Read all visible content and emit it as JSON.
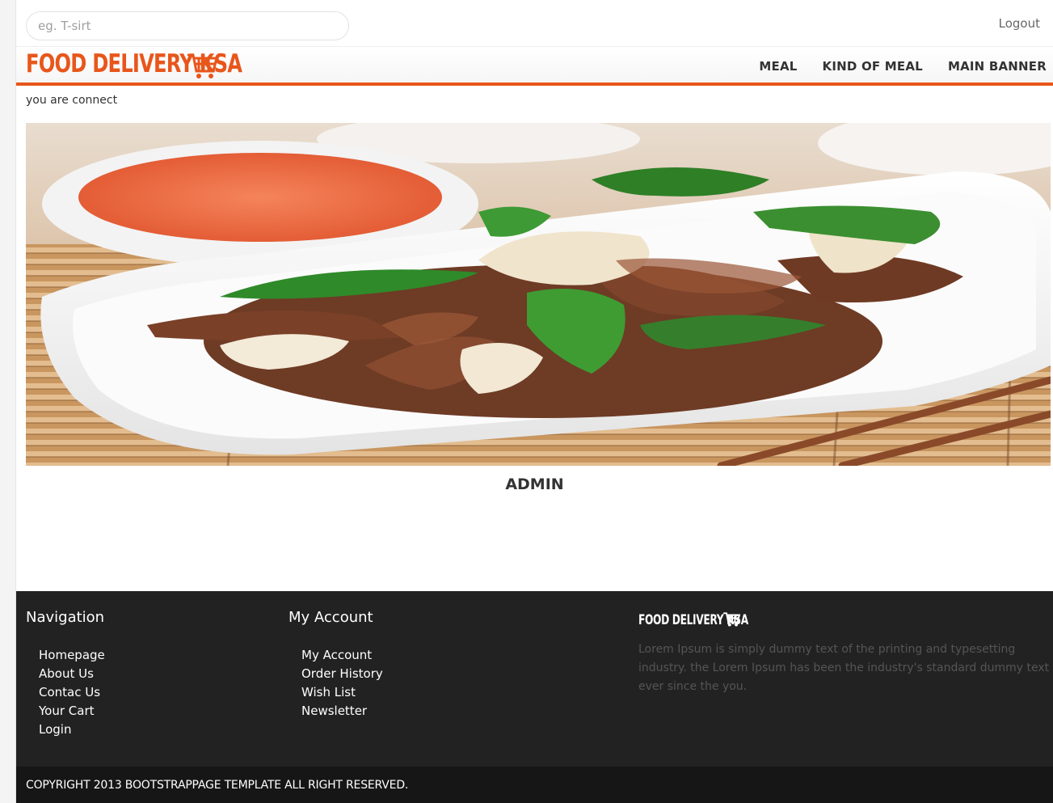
{
  "search": {
    "placeholder": "eg. T-sirt"
  },
  "topbar": {
    "logout_label": "Logout"
  },
  "brand": {
    "logo_text": "FOOD DELIVERY KSA",
    "accent_color": "#e8561b"
  },
  "nav": {
    "items": [
      {
        "label": "MEAL"
      },
      {
        "label": "KIND OF MEAL"
      },
      {
        "label": "MAIN BANNER"
      }
    ]
  },
  "status_text": "you are connect",
  "banner": {
    "image_icon": "food-plate-image"
  },
  "main": {
    "title": "ADMIN"
  },
  "footer": {
    "navigation": {
      "heading": "Navigation",
      "links": [
        "Homepage",
        "About Us",
        "Contac Us",
        "Your Cart",
        "Login"
      ]
    },
    "account": {
      "heading": "My Account",
      "links": [
        "My Account",
        "Order History",
        "Wish List",
        "Newsletter"
      ]
    },
    "about": {
      "logo_text": "FOOD DELIVERY KSA",
      "description": "Lorem Ipsum is simply dummy text of the printing and typesetting industry. the Lorem Ipsum has been the industry's standard dummy text ever since the you."
    },
    "copyright": "COPYRIGHT 2013 BOOTSTRAPPAGE TEMPLATE ALL RIGHT RESERVED."
  }
}
